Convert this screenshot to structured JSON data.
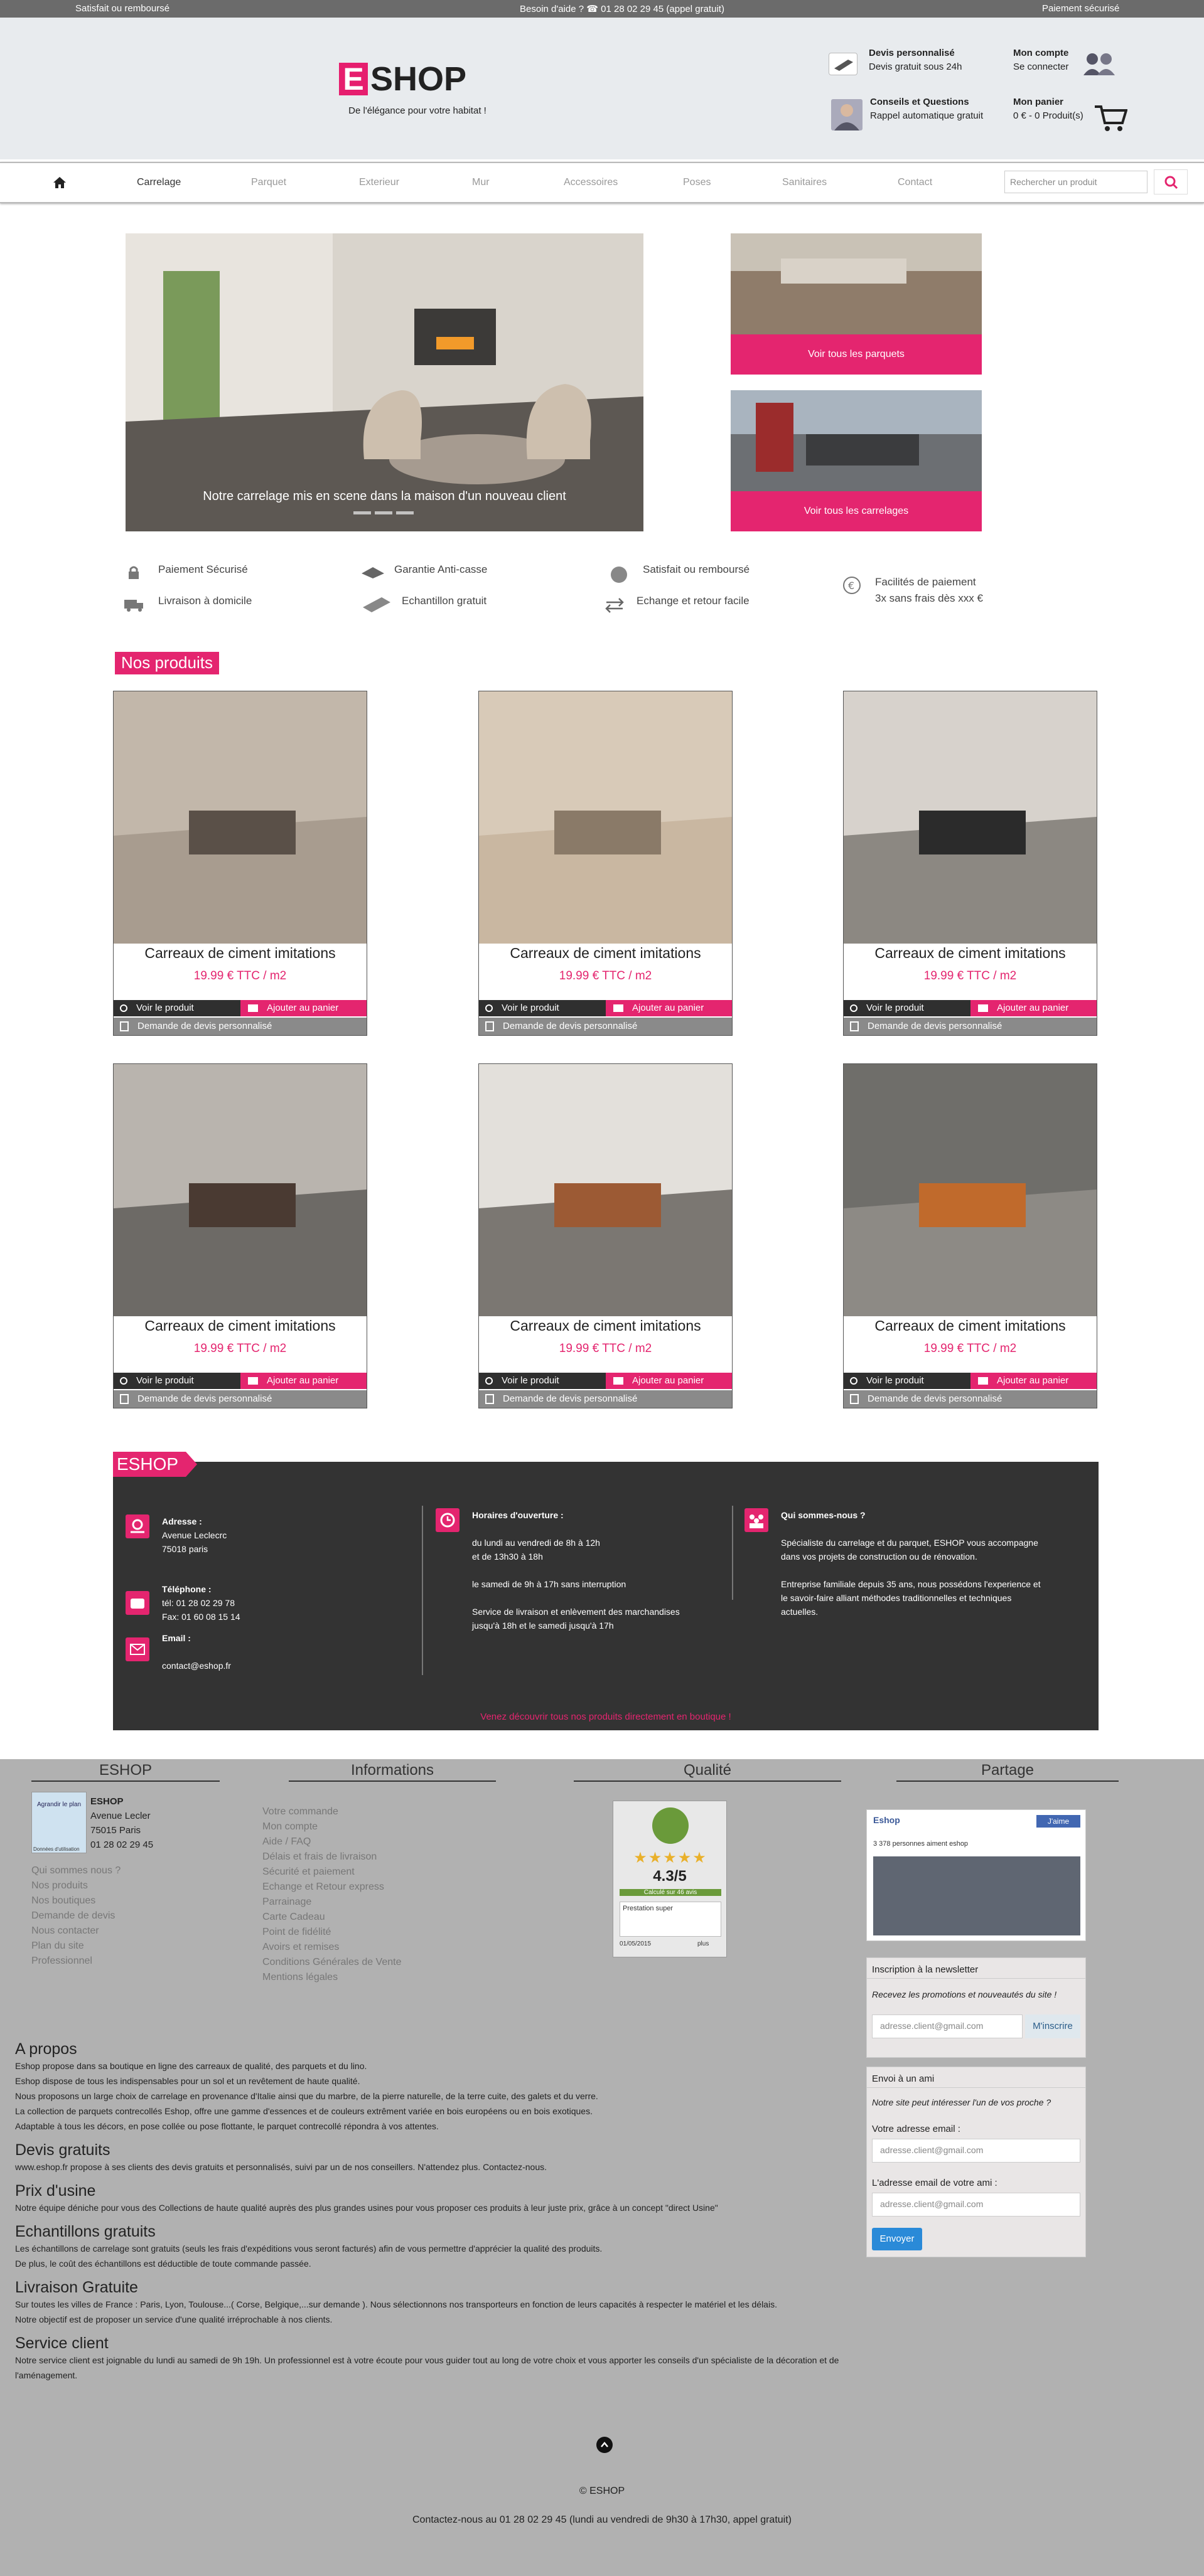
{
  "topbar": {
    "left": "Satisfait ou remboursé",
    "center": "Besoin d'aide ? ☎ 01 28 02 29 45 (appel gratuit)",
    "right": "Paiement sécurisé"
  },
  "logo": {
    "letter": "E",
    "rest": "SHOP",
    "tagline": "De l'élégance pour votre habitat !"
  },
  "header": {
    "quote_title": "Devis personnalisé",
    "quote_sub": "Devis gratuit sous 24h",
    "account_title": "Mon compte",
    "account_sub": "Se connecter",
    "advice_title": "Conseils et Questions",
    "advice_sub": "Rappel automatique gratuit",
    "cart_title": "Mon panier",
    "cart_sub": "0 € - 0 Produit(s)"
  },
  "nav": {
    "items": [
      "Carrelage",
      "Parquet",
      "Exterieur",
      "Mur",
      "Accessoires",
      "Poses",
      "Sanitaires",
      "Contact"
    ],
    "search_placeholder": "Rechercher un produit"
  },
  "hero": {
    "caption": "Notre carrelage mis en scene dans la maison d'un nouveau client"
  },
  "side": {
    "parquet": "Voir tous les parquets",
    "carrelage": "Voir tous les carrelages"
  },
  "features": {
    "secure": "Paiement Sécurisé",
    "delivery": "Livraison à domicile",
    "guarantee": "Garantie Anti-casse",
    "sample": "Echantillon gratuit",
    "satisfied": "Satisfait ou remboursé",
    "exchange": "Echange et retour facile",
    "payment1": "Facilités de paiement",
    "payment2": "3x sans frais dès xxx €"
  },
  "products": {
    "title": "Nos produits",
    "view": "Voir le produit",
    "cart": "Ajouter au panier",
    "quote": "Demande de devis personnalisé",
    "items": [
      {
        "name": "Carreaux de ciment imitations",
        "price": "19.99 € TTC / m2"
      },
      {
        "name": "Carreaux de ciment imitations",
        "price": "19.99 € TTC / m2"
      },
      {
        "name": "Carreaux de ciment imitations",
        "price": "19.99 € TTC / m2"
      },
      {
        "name": "Carreaux de ciment imitations",
        "price": "19.99 € TTC / m2"
      },
      {
        "name": "Carreaux de ciment imitations",
        "price": "19.99 € TTC / m2"
      },
      {
        "name": "Carreaux de ciment imitations",
        "price": "19.99 € TTC / m2"
      }
    ]
  },
  "info": {
    "tag": "ESHOP",
    "address_title": "Adresse :",
    "address_l1": "Avenue Leclecrc",
    "address_l2": "75018 paris",
    "phone_title": "Téléphone :",
    "phone_l1": "tél: 01 28 02 29 78",
    "phone_l2": "Fax: 01 60 08 15 14",
    "email_title": "Email :",
    "email": "contact@eshop.fr",
    "hours_title": "Horaires d'ouverture :",
    "hours_l1": "du lundi au vendredi de 8h à 12h",
    "hours_l2": "et de 13h30 à 18h",
    "hours_l3": "le samedi de 9h à 17h sans interruption",
    "hours_l4": "Service de livraison et enlèvement des marchandises",
    "hours_l5": "jusqu'à 18h et le samedi jusqu'à 17h",
    "who_title": "Qui sommes-nous ?",
    "who_l1": "Spécialiste du carrelage et du parquet, ESHOP vous accompagne",
    "who_l2": "dans vos projets de construction ou de rénovation.",
    "who_l3": "Entreprise familiale depuis 35 ans, nous possédons l'experience et",
    "who_l4": "le savoir-faire alliant méthodes traditionnelles et techniques",
    "who_l5": "actuelles.",
    "cta": "Venez découvrir tous nos produits directement en boutique !"
  },
  "footer": {
    "col1_title": "ESHOP",
    "col2_title": "Informations",
    "col3_title": "Qualité",
    "col4_title": "Partage",
    "map_label": "Agrandir le plan",
    "map_note": "Données d'utilisation",
    "shop_name": "ESHOP",
    "shop_l1": "Avenue Lecler",
    "shop_l2": "75015 Paris",
    "shop_l3": "01 28 02 29 45",
    "col1_links": [
      "Qui sommes nous ?",
      "Nos produits",
      "Nos boutiques",
      "Demande de devis",
      "Nous contacter",
      "Plan du site",
      "Professionnel"
    ],
    "col2_links": [
      "Votre commande",
      "Mon compte",
      "Aide / FAQ",
      "Délais et frais de livraison",
      "Sécurité et paiement",
      "Echange et Retour express",
      "Parrainage",
      "Carte Cadeau",
      "Point de fidélité",
      "Avoirs et remises",
      "Conditions Générales de Vente",
      "Mentions légales"
    ],
    "rating": "4.3/5",
    "rating_sub": "Calculé sur 46 avis",
    "review": "Prestation super",
    "review_date": "01/05/2015",
    "review_more": "plus",
    "fb_name": "Eshop",
    "fb_like": "J'aime",
    "fb_count": "3 378 personnes aiment eshop",
    "newsletter_title": "Inscription à la newsletter",
    "newsletter_sub": "Recevez les promotions et nouveautés du site !",
    "newsletter_placeholder": "adresse.client@gmail.com",
    "newsletter_btn": "M'inscrire",
    "friend_title": "Envoi à un ami",
    "friend_sub": "Notre site peut intéresser l'un de vos proche ?",
    "friend_email_label": "Votre adresse email :",
    "friend_email_placeholder": "adresse.client@gmail.com",
    "friend_friend_label": "L'adresse email de votre ami :",
    "friend_friend_placeholder": "adresse.client@gmail.com",
    "friend_btn": "Envoyer",
    "copyright": "© ESHOP",
    "contact": "Contactez-nous au 01 28 02 29 45 (lundi au vendredi de 9h30 à 17h30, appel gratuit)"
  },
  "about": {
    "h1": "A propos",
    "p1": "Eshop propose dans sa boutique en ligne des carreaux de qualité, des parquets et du lino.",
    "p2": "Eshop dispose de tous les indispensables pour un sol et un revêtement de haute qualité.",
    "p3": "Nous proposons un large choix de carrelage en provenance d'Italie ainsi que du marbre, de la pierre naturelle, de la terre cuite, des galets et du verre.",
    "p4": "La collection de parquets contrecollés Eshop, offre une gamme d'essences et de couleurs extrêment variée en bois européens ou en bois exotiques.",
    "p5": "Adaptable à tous les décors, en pose collée ou pose flottante, le parquet contrecollé répondra à vos attentes.",
    "h2": "Devis gratuits",
    "p6": "www.eshop.fr propose à ses clients des devis gratuits et personnalisés, suivi par un de nos conseillers. N'attendez plus. Contactez-nous.",
    "h3": "Prix d'usine",
    "p7": "Notre équipe déniche pour vous des Collections de haute qualité auprès des plus grandes usines pour vous proposer ces produits à leur juste prix, grâce à un concept \"direct Usine\"",
    "h4": "Echantillons gratuits",
    "p8": "Les échantillons de carrelage sont gratuits (seuls les frais d'expéditions vous seront facturés) afin de vous permettre d'apprécier la qualité des produits.",
    "p9": "De plus, le coût des échantillons est déductible de toute commande passée.",
    "h5": "Livraison Gratuite",
    "p10": "Sur toutes les villes de France : Paris, Lyon, Toulouse...( Corse, Belgique,...sur demande ). Nous sélectionnons nos transporteurs en fonction de leurs capacités à respecter le matériel et les délais.",
    "p11": "Notre objectif est de proposer un service d'une qualité irréprochable à nos clients.",
    "h6": "Service client",
    "p12": "Notre service client est joignable du lundi au samedi de 9h 19h. Un professionnel est à votre écoute pour vous guider tout au long de votre choix et vous apporter les conseils d'un spécialiste de la décoration et de l'aménagement."
  }
}
